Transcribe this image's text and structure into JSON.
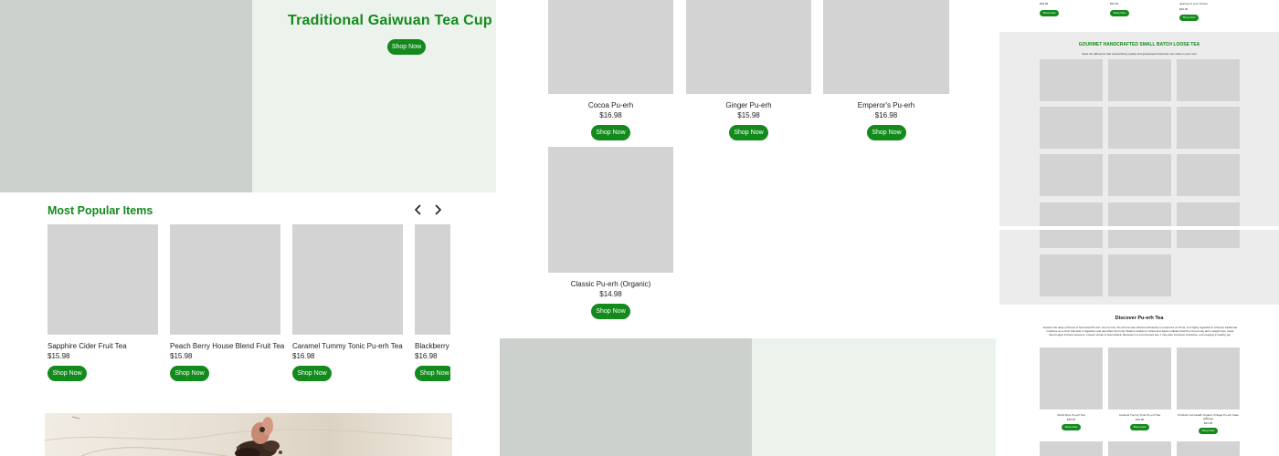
{
  "colors": {
    "accent": "#138a1c",
    "hero_left": "#ccd1ce",
    "hero_right": "#ecf3ec",
    "placeholder": "#d3d3d3",
    "band": "#ececec"
  },
  "hero": {
    "title": "Traditional Gaiwuan Tea Cup & Gift",
    "button": "Shop Now"
  },
  "popular": {
    "heading": "Most Popular Items",
    "prev_icon": "chevron-left-icon",
    "next_icon": "chevron-right-icon",
    "items": [
      {
        "name": "Sapphire Cider Fruit Tea",
        "price": "$15.98",
        "button": "Shop Now"
      },
      {
        "name": "Peach Berry House Blend Fruit Tea",
        "price": "$15.98",
        "button": "Shop Now"
      },
      {
        "name": "Caramel Tummy Tonic Pu-erh Tea",
        "price": "$16.98",
        "button": "Shop Now"
      },
      {
        "name": "Blackberry",
        "price": "$16.98",
        "button": "Shop Now"
      }
    ]
  },
  "puerh_grid": {
    "items": [
      {
        "name": "Cocoa Pu-erh",
        "price": "$16.98",
        "button": "Shop Now"
      },
      {
        "name": "Ginger Pu-erh",
        "price": "$15.98",
        "button": "Shop Now"
      },
      {
        "name": "Emperor's Pu-erh",
        "price": "$16.98",
        "button": "Shop Now"
      },
      {
        "name": "Classic Pu-erh (Organic)",
        "price": "$14.98",
        "button": "Shop Now"
      }
    ]
  },
  "mini_page": {
    "top_prices": [
      "$28.99",
      "$94.50",
      "$49.99"
    ],
    "top_snippets": [
      "deal tea of your Choice"
    ],
    "top_buttons": [
      "Shop Now",
      "Shop Now",
      "Shop Now"
    ],
    "gourmet_title": "GOURMET HANDCRAFTED SMALL BATCH LOOSE TEA",
    "gourmet_sub": "Taste the difference that extraordinary quality and guaranteed freshness can make in your cup!",
    "discover_title": "Discover Pu-erh Tea",
    "discover_body": "Explore the deep richness of fermented Pu-erh. At one time, Pu-erh tea was offered exclusively to emperors of China. It is highly regarded in Chinese traditional medicine as a tonic that aids in digestion and detoxifies the body. Modern studies in China and Japan indicate that Pu-erh tea may aid in weight loss, lower blood sugar & blood pressure, prevent stroke & heart attack. Because it is a fermented tea, it may also introduce probiotics, encouraging a healthy gut.",
    "discover_items": [
      {
        "name": "Mochi Rice Pu-erh Tea",
        "price": "$28.95",
        "button": "Shop Now"
      },
      {
        "name": "Caramel Tummy Tonic Pu-erh Tea",
        "price": "$16.98",
        "button": "Shop Now"
      },
      {
        "name": "Probiotic Gut Health Organic Vintage Pu-erh Cake (200mg)",
        "price": "$64.98",
        "button": "Shop Now"
      }
    ]
  }
}
